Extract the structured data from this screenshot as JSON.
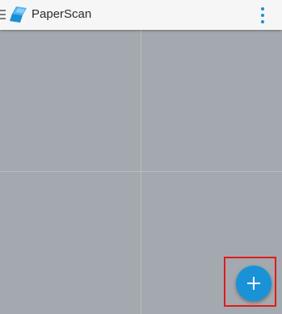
{
  "app_bar": {
    "title": "PaperScan",
    "menu_icon": "hamburger-menu-icon",
    "logo_icon": "paperscan-logo-icon",
    "overflow_icon": "more-vert-icon",
    "accent_color": "#1a8fd6"
  },
  "gallery": {
    "tiles": 4,
    "tile_color": "#a3a9ae"
  },
  "fab": {
    "icon": "plus-icon",
    "color": "#1a92d8"
  },
  "annotation": {
    "highlight_color": "#e01b1b"
  }
}
